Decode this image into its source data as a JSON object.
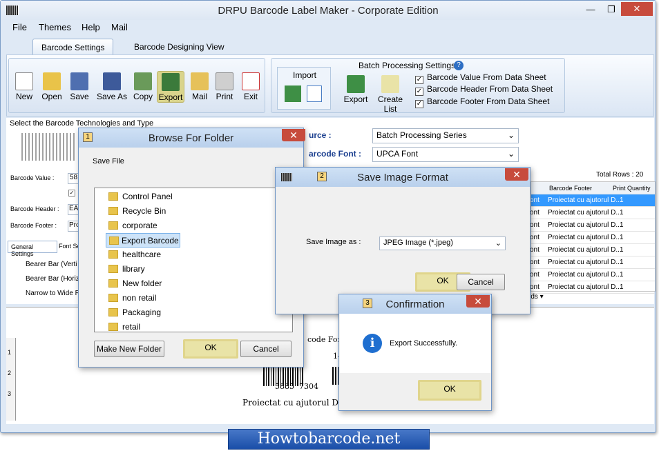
{
  "app": {
    "title": "DRPU Barcode Label Maker - Corporate Edition",
    "min": "—",
    "max": "❐",
    "close": "✕"
  },
  "menu": [
    "File",
    "Themes",
    "Help",
    "Mail"
  ],
  "tabs": [
    "Barcode Settings",
    "Barcode Designing View"
  ],
  "toolbar": [
    "New",
    "Open",
    "Save",
    "Save As",
    "Copy",
    "Export",
    "Mail",
    "Print",
    "Exit"
  ],
  "import": {
    "label": "Import"
  },
  "batch": {
    "title": "Batch Processing Settings",
    "help": "?",
    "export": "Export",
    "create_list": "Create List",
    "checks": [
      "Barcode Value From Data Sheet",
      "Barcode Header From Data Sheet",
      "Barcode Footer From Data Sheet"
    ]
  },
  "left": {
    "select_label": "Select the Barcode Technologies and Type",
    "barcode_value": "Barcode Value :",
    "value_text": "58",
    "barcode_header": "Barcode Header :",
    "header_text": "EA",
    "barcode_footer": "Barcode Footer :",
    "footer_text": "Pro",
    "tab_general": "General Settings",
    "tab_font": "Font Se",
    "bearer_vert": "Bearer Bar (Verti",
    "bearer_hori": "Bearer Bar (Horiz",
    "narrow": "Narrow to Wide R"
  },
  "form": {
    "source_label": "urce :",
    "source_value": "Batch Processing Series",
    "font_label": "arcode Font :",
    "font_value": "UPCA Font"
  },
  "grid": {
    "total": "Total Rows : 20",
    "col_footer": "Barcode Footer",
    "col_qty": "Print Quantity",
    "cell_left": "ont",
    "cell_footer": "Proiectat cu ajutorul D...",
    "cell_qty": "1",
    "more": "rds ▾"
  },
  "preview": {
    "font_text": "code For",
    "num_a": "5885",
    "num_b": "7304",
    "num_side": "14",
    "caption": "Proiectat cu ajutorul DRPU",
    "ruler": [
      "1",
      "2",
      "3"
    ]
  },
  "browse": {
    "num": "1",
    "title": "Browse For Folder",
    "save_file": "Save  File",
    "items": [
      "Control Panel",
      "Recycle Bin",
      "corporate",
      "Export Barcode",
      "healthcare",
      "library",
      "New folder",
      "non retail",
      "Packaging",
      "retail"
    ],
    "make_new": "Make New Folder",
    "ok": "OK",
    "cancel": "Cancel"
  },
  "saveimg": {
    "num": "2",
    "title": "Save Image Format",
    "label": "Save Image as :",
    "value": "JPEG Image (*.jpeg)",
    "ok": "OK",
    "cancel": "Cancel"
  },
  "confirm": {
    "num": "3",
    "title": "Confirmation",
    "icon": "i",
    "message": "Export Successfully.",
    "ok": "OK"
  },
  "footer": {
    "brand": "Howtobarcode.net"
  }
}
